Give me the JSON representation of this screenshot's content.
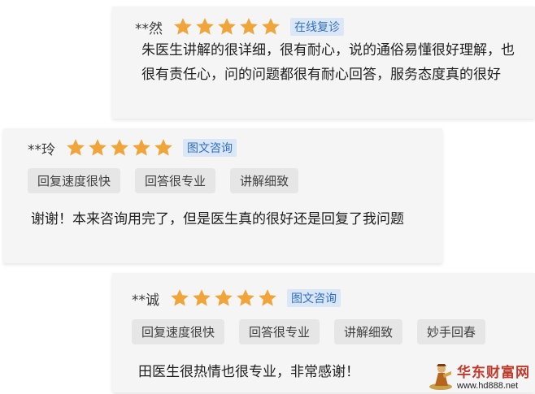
{
  "colors": {
    "star": "#f0a53a",
    "badge_text": "#2f6fc4",
    "badge_bg": "#dbe7f6",
    "card_bg": "#f5f5f5",
    "tag_bg": "#e6e6e6",
    "watermark": "#c0392b"
  },
  "reviews": [
    {
      "name": "**然",
      "stars": 5,
      "badge": "在线复诊",
      "tags": [],
      "text": "朱医生讲解的很详细，很有耐心，说的通俗易懂很好理解，也很有责任心，问的问题都很有耐心回答，服务态度真的很好"
    },
    {
      "name": "**玲",
      "stars": 5,
      "badge": "图文咨询",
      "tags": [
        "回复速度很快",
        "回答很专业",
        "讲解细致"
      ],
      "text": "谢谢！本来咨询用完了，但是医生真的很好还是回复了我问题"
    },
    {
      "name": "**诚",
      "stars": 5,
      "badge": "图文咨询",
      "tags": [
        "回复速度很快",
        "回答很专业",
        "讲解细致",
        "妙手回春"
      ],
      "text": "田医生很热情也很专业，非常感谢！"
    }
  ],
  "watermark": {
    "icon": "figure-logo-icon",
    "brand": "华东财富网",
    "url": "www.hd888.net"
  }
}
